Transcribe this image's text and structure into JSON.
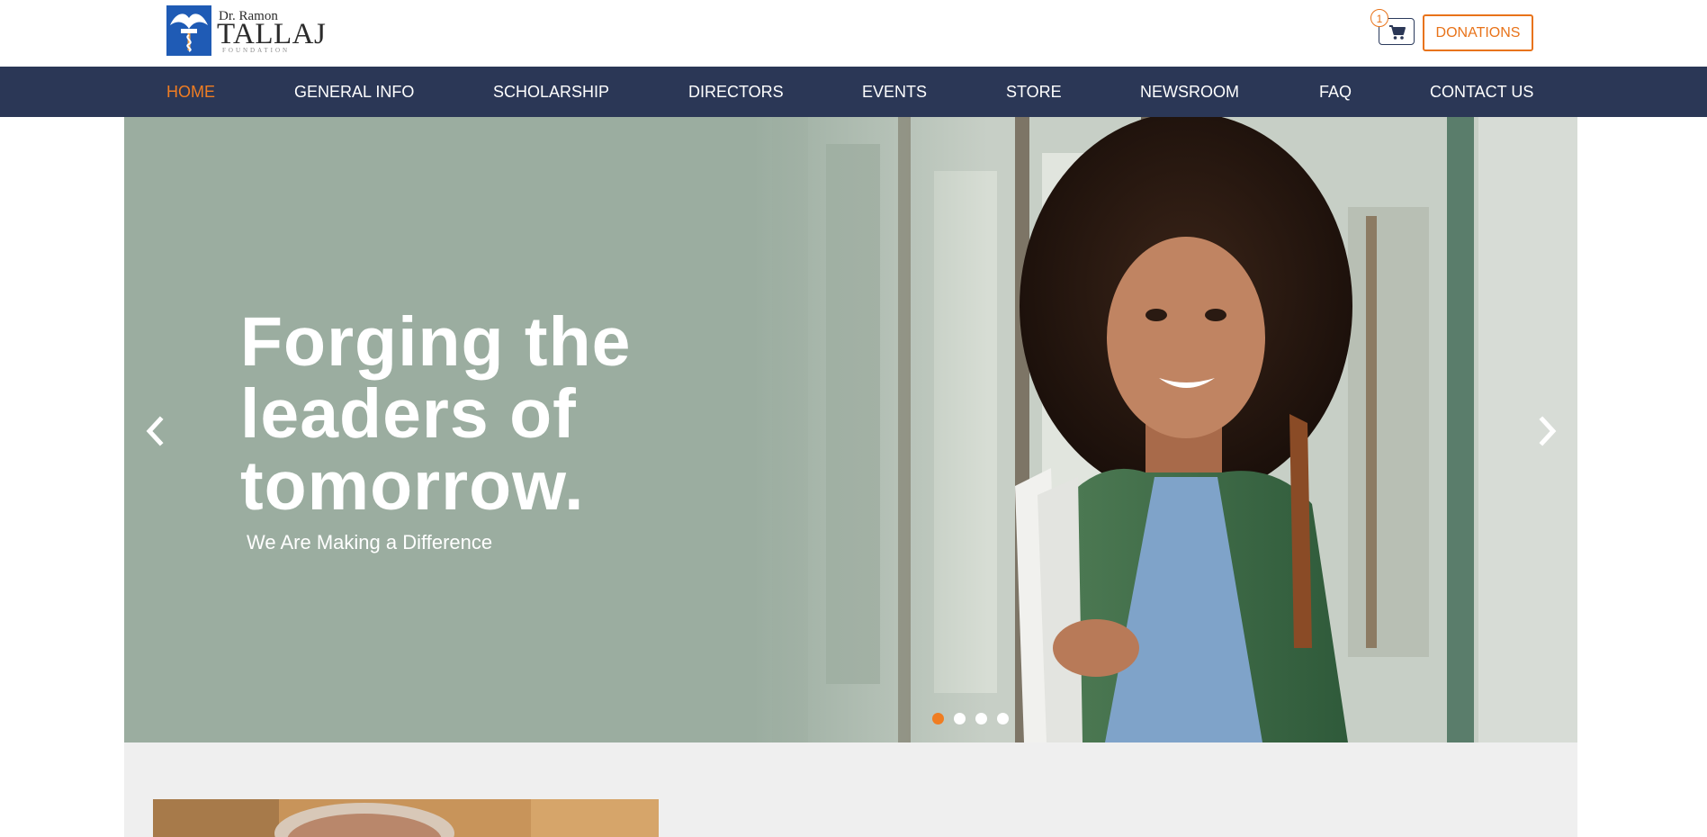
{
  "logo": {
    "line1": "Dr. Ramon",
    "line2": "TALLAJ",
    "line3": "FOUNDATION"
  },
  "header": {
    "cart_count": "1",
    "donate_label": "DONATIONS"
  },
  "nav": {
    "items": [
      {
        "label": "HOME",
        "active": true
      },
      {
        "label": "GENERAL INFO",
        "active": false
      },
      {
        "label": "SCHOLARSHIP",
        "active": false
      },
      {
        "label": "DIRECTORS",
        "active": false
      },
      {
        "label": "EVENTS",
        "active": false
      },
      {
        "label": "STORE",
        "active": false
      },
      {
        "label": "NEWSROOM",
        "active": false
      },
      {
        "label": "FAQ",
        "active": false
      },
      {
        "label": "CONTACT US",
        "active": false
      }
    ]
  },
  "hero": {
    "title": "Forging the leaders of tomorrow.",
    "subtitle": "We Are Making a Difference",
    "slide_count": 4,
    "active_slide": 1
  },
  "colors": {
    "accent": "#f07d22",
    "nav_bg": "#2b3756",
    "hero_bg": "#9bada0",
    "brand_blue": "#1f5bb5"
  },
  "icons": {
    "cart": "cart-icon",
    "prev": "chevron-left-icon",
    "next": "chevron-right-icon"
  }
}
